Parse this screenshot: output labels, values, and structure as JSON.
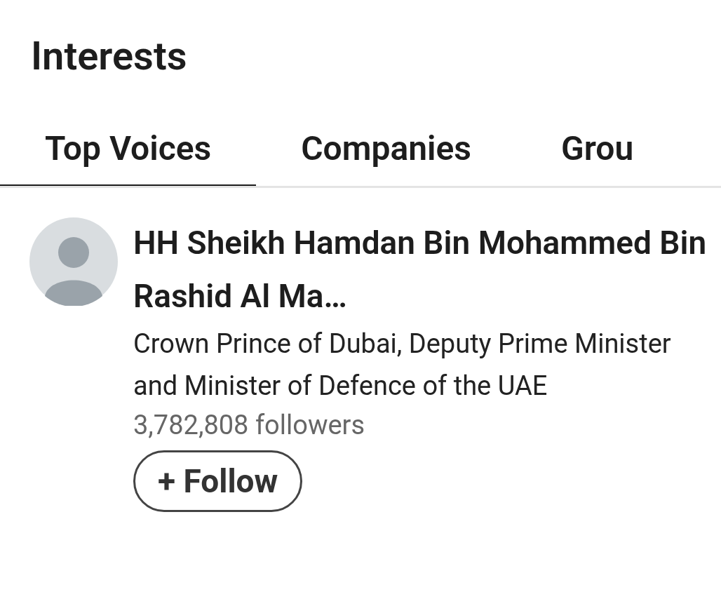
{
  "header": {
    "title": "Interests"
  },
  "tabs": [
    {
      "label": "Top Voices",
      "selected": true
    },
    {
      "label": "Companies",
      "selected": false
    },
    {
      "label": "Grou",
      "selected": false
    }
  ],
  "people": [
    {
      "name": "HH Sheikh Hamdan Bin Mohammed Bin Rashid Al Ma…",
      "headline": "Crown Prince of Dubai, Deputy Prime Minister and Minister of Defence of the UAE",
      "followers": "3,782,808 followers",
      "follow_button": "+ Follow"
    }
  ]
}
